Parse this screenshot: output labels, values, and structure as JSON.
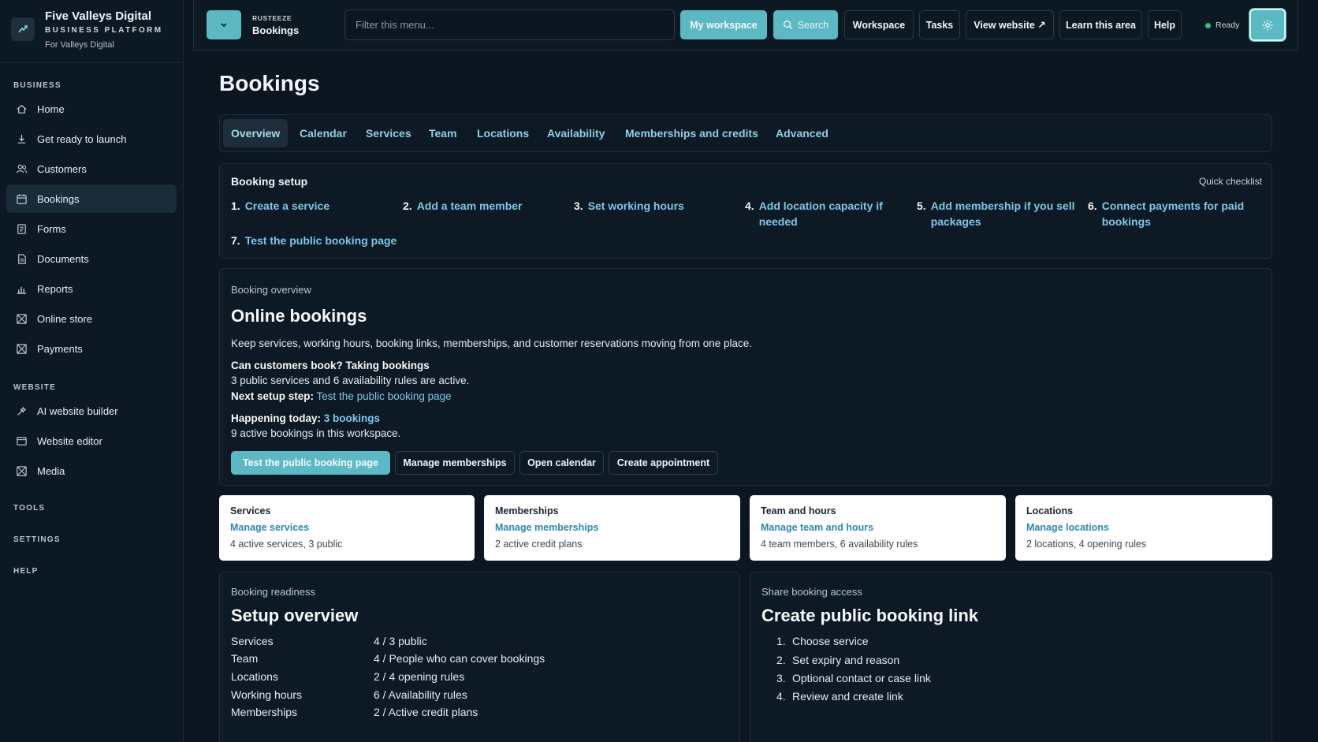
{
  "brand": {
    "name": "Five Valleys Digital",
    "subtitle": "BUSINESS PLATFORM",
    "for": "For Valleys Digital"
  },
  "sidebar": {
    "sections": {
      "business": "BUSINESS",
      "website": "WEBSITE",
      "tools": "TOOLS",
      "settings": "SETTINGS",
      "help": "HELP"
    },
    "business_items": [
      {
        "label": "Home",
        "icon": "home-icon"
      },
      {
        "label": "Get ready to launch",
        "icon": "download-icon"
      },
      {
        "label": "Customers",
        "icon": "users-icon"
      },
      {
        "label": "Bookings",
        "icon": "calendar-icon",
        "active": true
      },
      {
        "label": "Forms",
        "icon": "form-icon"
      },
      {
        "label": "Documents",
        "icon": "document-icon"
      },
      {
        "label": "Reports",
        "icon": "bar-chart-icon"
      },
      {
        "label": "Online store",
        "icon": "store-icon"
      },
      {
        "label": "Payments",
        "icon": "payments-icon"
      }
    ],
    "website_items": [
      {
        "label": "AI website builder",
        "icon": "sparkle-icon"
      },
      {
        "label": "Website editor",
        "icon": "editor-icon"
      },
      {
        "label": "Media",
        "icon": "media-icon"
      }
    ]
  },
  "topbar": {
    "crumb_small": "RUSTEEZE",
    "crumb_main": "Bookings",
    "filter_placeholder": "Filter this menu...",
    "buttons": {
      "my_workspace": "My workspace",
      "search": "Search",
      "workspace": "Workspace",
      "tasks": "Tasks",
      "view_website": "View website ↗",
      "learn": "Learn this area",
      "help": "Help"
    },
    "status": "Ready",
    "accent": "#5cb8c2"
  },
  "page": {
    "title": "Bookings"
  },
  "tabs": [
    "Overview",
    "Calendar",
    "Services",
    "Team",
    "Locations",
    "Availability",
    "Memberships and credits",
    "Advanced"
  ],
  "setup": {
    "title": "Booking setup",
    "quick": "Quick checklist",
    "steps": [
      {
        "num": "1.",
        "label": "Create a service"
      },
      {
        "num": "2.",
        "label": "Add a team member"
      },
      {
        "num": "3.",
        "label": "Set working hours"
      },
      {
        "num": "4.",
        "label": "Add location capacity if needed"
      },
      {
        "num": "5.",
        "label": "Add membership if you sell packages"
      },
      {
        "num": "6.",
        "label": "Connect payments for paid bookings"
      },
      {
        "num": "7.",
        "label": "Test the public booking page"
      }
    ]
  },
  "overview": {
    "label": "Booking overview",
    "title": "Online bookings",
    "desc": "Keep services, working hours, booking links, memberships, and customer reservations moving from one place.",
    "can_book_label": "Can customers book?",
    "can_book_value": "Taking bookings",
    "can_book_detail": "3 public services and 6 availability rules are active.",
    "next_step_label": "Next setup step:",
    "next_step_link": "Test the public booking page",
    "today_label": "Happening today:",
    "today_link": "3 bookings",
    "today_detail": "9 active bookings in this workspace.",
    "buttons": {
      "primary": "Test the public booking page",
      "memberships": "Manage memberships",
      "calendar": "Open calendar",
      "appointment": "Create appointment"
    }
  },
  "cards": [
    {
      "title": "Services",
      "link": "Manage services",
      "meta": "4 active services, 3 public"
    },
    {
      "title": "Memberships",
      "link": "Manage memberships",
      "meta": "2 active credit plans"
    },
    {
      "title": "Team and hours",
      "link": "Manage team and hours",
      "meta": "4 team members, 6 availability rules"
    },
    {
      "title": "Locations",
      "link": "Manage locations",
      "meta": "2 locations, 4 opening rules"
    }
  ],
  "readiness": {
    "label": "Booking readiness",
    "title": "Setup overview",
    "rows": [
      {
        "key": "Services",
        "value": "4 / 3 public"
      },
      {
        "key": "Team",
        "value": "4 / People who can cover bookings"
      },
      {
        "key": "Locations",
        "value": "2 / 4 opening rules"
      },
      {
        "key": "Working hours",
        "value": "6 / Availability rules"
      },
      {
        "key": "Memberships",
        "value": "2 / Active credit plans"
      }
    ]
  },
  "share": {
    "label": "Share booking access",
    "title": "Create public booking link",
    "steps": [
      {
        "n": "1.",
        "text": "Choose service"
      },
      {
        "n": "2.",
        "text": "Set expiry and reason"
      },
      {
        "n": "3.",
        "text": "Optional contact or case link"
      },
      {
        "n": "4.",
        "text": "Review and create link"
      }
    ]
  }
}
